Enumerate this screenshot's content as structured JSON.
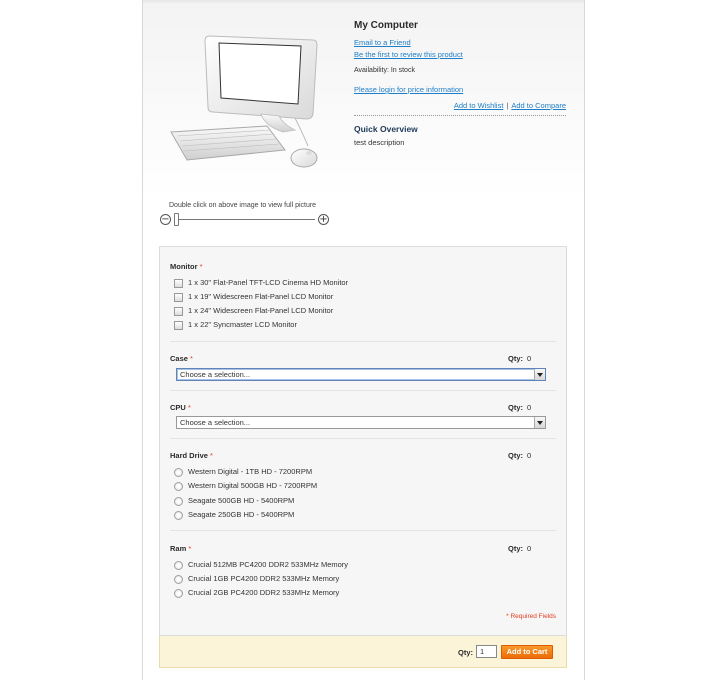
{
  "product": {
    "title": "My Computer",
    "email_link": "Email to a Friend",
    "review_link": "Be the first to review this product",
    "availability": "Availability: In stock",
    "login_link": "Please login for price information",
    "wishlist_link": "Add to Wishlist",
    "separator": "|",
    "compare_link": "Add to Compare",
    "overview_title": "Quick Overview",
    "overview_desc": "test description",
    "image_icon": "computer-image",
    "image_caption": "Double click on above image to view full picture",
    "zoom_out": "−",
    "zoom_in": "+"
  },
  "options": {
    "required_marker": "*",
    "monitor": {
      "label": "Monitor",
      "items": [
        "1 x 30\" Flat-Panel TFT-LCD Cinema HD Monitor",
        "1 x 19\" Widescreen Flat-Panel LCD Monitor",
        "1 x 24\" Widescreen Flat-Panel LCD Monitor",
        "1 x 22\" Syncmaster LCD Monitor"
      ]
    },
    "case": {
      "label": "Case",
      "qty_label": "Qty:",
      "qty": "0",
      "select_value": "Choose a selection..."
    },
    "cpu": {
      "label": "CPU",
      "qty_label": "Qty:",
      "qty": "0",
      "select_value": "Choose a selection..."
    },
    "hard_drive": {
      "label": "Hard Drive",
      "qty_label": "Qty:",
      "qty": "0",
      "items": [
        "Western Digital - 1TB HD - 7200RPM",
        "Western Digital 500GB HD - 7200RPM",
        "Seagate 500GB HD - 5400RPM",
        "Seagate 250GB HD - 5400RPM"
      ]
    },
    "ram": {
      "label": "Ram",
      "qty_label": "Qty:",
      "qty": "0",
      "items": [
        "Crucial 512MB PC4200 DDR2 533MHz Memory",
        "Crucial 1GB PC4200 DDR2 533MHz Memory",
        "Crucial 2GB PC4200 DDR2 533MHz Memory"
      ]
    },
    "required_note": "* Required Fields"
  },
  "cart": {
    "qty_label": "Qty:",
    "qty_value": "1",
    "button_label": "Add to Cart"
  },
  "colors": {
    "link": "#1e7ec8",
    "required": "#e43d1f",
    "cart_button": "#ec6b08",
    "cart_bar": "#fbf4d8"
  }
}
